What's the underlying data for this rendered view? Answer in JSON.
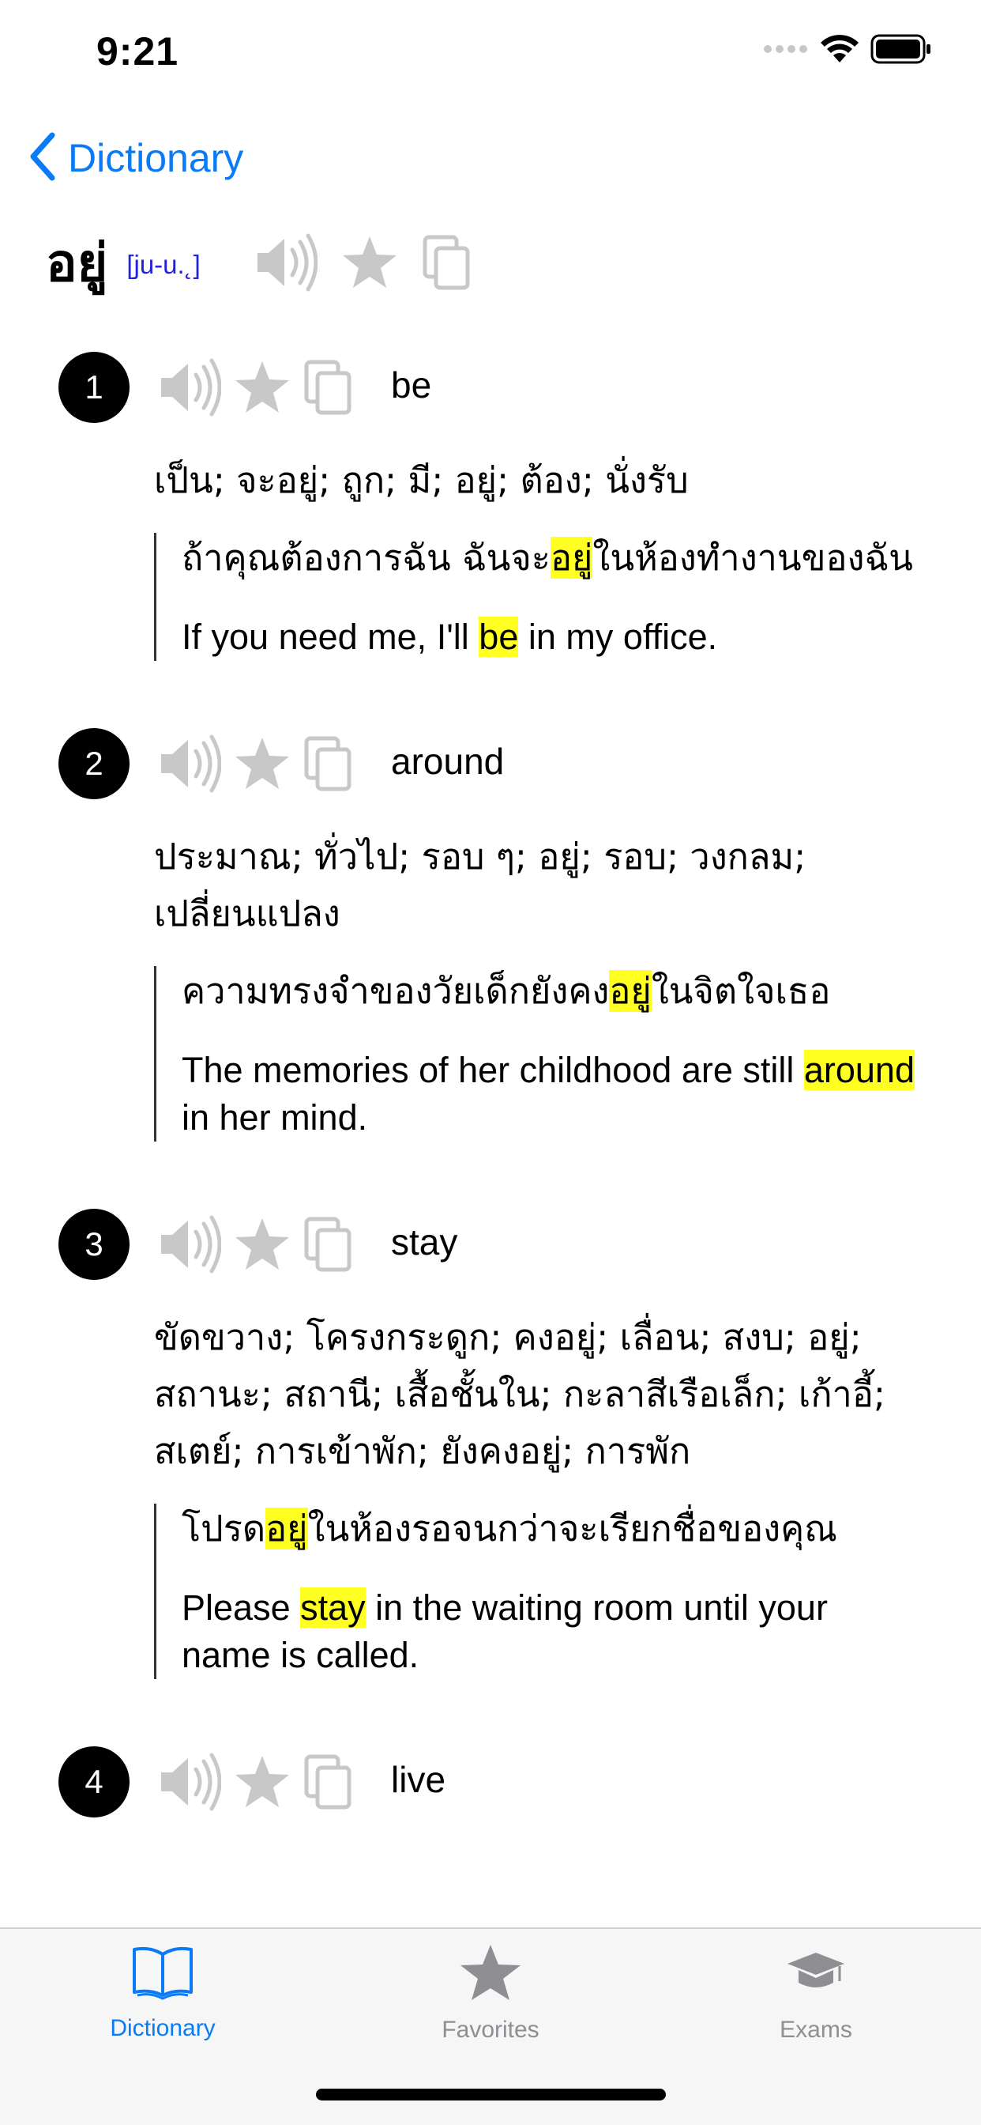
{
  "status_bar": {
    "time": "9:21"
  },
  "nav": {
    "back_label": "Dictionary"
  },
  "entry": {
    "headword": "อยู่",
    "phonetic": "[ju-u.˛]"
  },
  "senses": [
    {
      "number": "1",
      "word": "be",
      "thai_defs": "เป็น; จะอยู่; ถูก; มี; อยู่; ต้อง; นั่งรับ",
      "example_thai": {
        "before": "ถ้าคุณต้องการฉัน ฉันจะ",
        "highlight": "อยู่",
        "after": "ในห้องทำงานของฉัน"
      },
      "example_en": {
        "before": "If you need me, I'll ",
        "highlight": "be",
        "after": " in my office."
      }
    },
    {
      "number": "2",
      "word": "around",
      "thai_defs": "ประมาณ; ทั่วไป; รอบ ๆ; อยู่; รอบ; วงกลม; เปลี่ยนแปลง",
      "example_thai": {
        "before": "ความทรงจำของวัยเด็กยังคง",
        "highlight": "อยู่",
        "after": "ในจิตใจเธอ"
      },
      "example_en": {
        "before": "The memories of her childhood are still ",
        "highlight": "around",
        "after": " in her mind."
      }
    },
    {
      "number": "3",
      "word": "stay",
      "thai_defs": "ขัดขวาง; โครงกระดูก; คงอยู่; เลื่อน; สงบ; อยู่; สถานะ; สถานี; เสื้อชั้นใน; กะลาสีเรือเล็ก; เก้าอี้; สเตย์; การเข้าพัก; ยังคงอยู่; การพัก",
      "example_thai": {
        "before": "โปรด",
        "highlight": "อยู่",
        "after": "ในห้องรอจนกว่าจะเรียกชื่อของคุณ"
      },
      "example_en": {
        "before": "Please ",
        "highlight": "stay",
        "after": " in the waiting room until your name is called."
      }
    },
    {
      "number": "4",
      "word": "live"
    }
  ],
  "tabs": [
    {
      "label": "Dictionary",
      "icon": "open-book-icon",
      "active": true
    },
    {
      "label": "Favorites",
      "icon": "star-icon",
      "active": false
    },
    {
      "label": "Exams",
      "icon": "graduation-cap-icon",
      "active": false
    }
  ],
  "colors": {
    "accent": "#0a7bf6",
    "highlight": "#ffff22",
    "icon_gray": "#c8c8c8",
    "inactive_tab": "#8e8e93"
  }
}
